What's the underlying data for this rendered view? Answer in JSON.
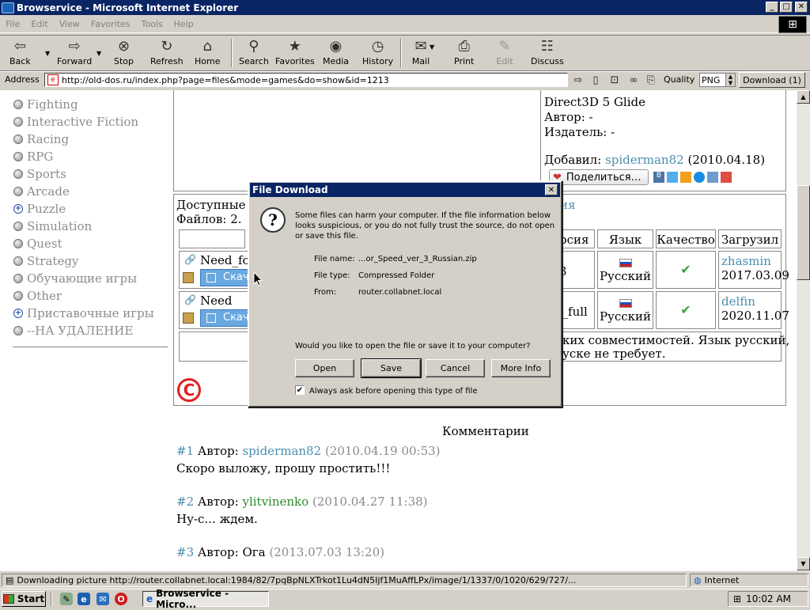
{
  "window": {
    "title": "Browservice - Microsoft Internet Explorer",
    "controls": {
      "minimize": "_",
      "maximize": "□",
      "close": "✕"
    }
  },
  "menu": [
    "File",
    "Edit",
    "View",
    "Favorites",
    "Tools",
    "Help"
  ],
  "toolbar": {
    "back": "Back",
    "forward": "Forward",
    "stop": "Stop",
    "refresh": "Refresh",
    "home": "Home",
    "search": "Search",
    "favorites": "Favorites",
    "media": "Media",
    "history": "History",
    "mail": "Mail",
    "print": "Print",
    "edit": "Edit",
    "discuss": "Discuss"
  },
  "address": {
    "label": "Address",
    "url": "http://old-dos.ru/index.php?page=files&mode=games&do=show&id=1213",
    "quality_label": "Quality",
    "quality_value": "PNG",
    "download_button": "Download (1)"
  },
  "categories": [
    {
      "label": "Fighting",
      "bullet": "circle"
    },
    {
      "label": "Interactive Fiction",
      "bullet": "circle"
    },
    {
      "label": "Racing",
      "bullet": "circle"
    },
    {
      "label": "RPG",
      "bullet": "circle"
    },
    {
      "label": "Sports",
      "bullet": "circle"
    },
    {
      "label": "Arcade",
      "bullet": "circle"
    },
    {
      "label": "Puzzle",
      "bullet": "plus"
    },
    {
      "label": "Simulation",
      "bullet": "circle"
    },
    {
      "label": "Quest",
      "bullet": "circle"
    },
    {
      "label": "Strategy",
      "bullet": "circle"
    },
    {
      "label": "Обучающие игры",
      "bullet": "circle"
    },
    {
      "label": "Other",
      "bullet": "circle"
    },
    {
      "label": "Приставочные игры",
      "bullet": "plus"
    },
    {
      "label": "--НА УДАЛЕНИЕ",
      "bullet": "circle"
    }
  ],
  "game_info": {
    "renderers": "Direct3D 5 Glide",
    "author": "Автор: -",
    "publisher": "Издатель: -",
    "added_label": "Добавил:",
    "added_user": "spiderman82",
    "added_date": "(2010.04.18)",
    "share_button": "Поделиться…"
  },
  "files_section": {
    "available_prefix": "Доступные ф",
    "count": "Файлов: 2.",
    "right_link_fragment": "ия",
    "headers": {
      "version": "рсия",
      "language": "Язык",
      "quality": "Качество",
      "uploader": "Загрузил"
    },
    "rows": [
      {
        "name": "Need_for",
        "download": "Скача",
        "version": "3",
        "language": "Русский",
        "uploader": "zhasmin",
        "date": "2017.03.09"
      },
      {
        "name": "Need For",
        "download": "Скача",
        "version": "0_full",
        "language": "Русский",
        "uploader": "delfin",
        "date": "2020.11.07"
      }
    ],
    "note_line1": "ких совместимостей. Язык русский,",
    "note_line2": "уске не требует."
  },
  "comments": {
    "heading": "Комментарии",
    "items": [
      {
        "num": "#1",
        "author_label": "Автор:",
        "author": "spiderman82",
        "date": "(2010.04.19 00:53)",
        "text": "Скоро выложу, прошу простить!!!",
        "author_style": "link"
      },
      {
        "num": "#2",
        "author_label": "Автор:",
        "author": "ylitvinenko",
        "date": "(2010.04.27 11:38)",
        "text": "Ну-с... ждем.",
        "author_style": "green"
      },
      {
        "num": "#3",
        "author_label": "Автор:",
        "author": "Ога",
        "date": "(2013.07.03 13:20)",
        "text": "",
        "author_style": "plain"
      }
    ]
  },
  "dialog": {
    "title": "File Download",
    "warning": "Some files can harm your computer. If the file information below looks suspicious, or you do not fully trust the source, do not open or save this file.",
    "file_name_label": "File name:",
    "file_name": "...or_Speed_ver_3_Russian.zip",
    "file_type_label": "File type:",
    "file_type": "Compressed Folder",
    "from_label": "From:",
    "from": "router.collabnet.local",
    "question": "Would you like to open the file or save it to your computer?",
    "buttons": {
      "open": "Open",
      "save": "Save",
      "cancel": "Cancel",
      "more_info": "More Info"
    },
    "checkbox_label": "Always ask before opening this type of file",
    "checkbox_checked": true
  },
  "status": {
    "text": "Downloading picture http://router.collabnet.local:1984/82/7pqBpNLXTrkot1Lu4dN5Ijf1MuAffLPx/image/1/1337/0/1020/629/727/...",
    "zone": "Internet"
  },
  "taskbar": {
    "start": "Start",
    "task": "Browservice - Micro...",
    "clock": "10:02 AM"
  }
}
